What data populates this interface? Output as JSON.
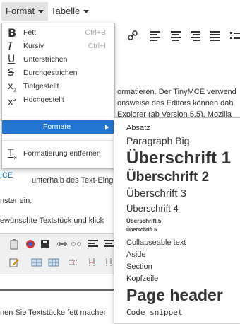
{
  "menubar": {
    "format": "Format",
    "table": "Tabelle"
  },
  "dropdown": {
    "items": [
      {
        "label": "Fett",
        "shortcut": "Ctrl+B",
        "icon": "bold-icon"
      },
      {
        "label": "Kursiv",
        "shortcut": "Ctrl+I",
        "icon": "italic-icon"
      },
      {
        "label": "Unterstrichen",
        "icon": "underline-icon"
      },
      {
        "label": "Durchgestrichen",
        "icon": "strikethrough-icon"
      },
      {
        "label": "Tiefgestellt",
        "icon": "subscript-icon"
      },
      {
        "label": "Hochgestellt",
        "icon": "superscript-icon"
      }
    ],
    "formats": "Formate",
    "clear": "Formatierung entfernen"
  },
  "submenu": [
    "Absatz",
    "Paragraph Big",
    "Überschrift 1",
    "Überschrift 2",
    "Überschrift 3",
    "Überschrift 4",
    "Überschrift 5",
    "Überschrift 6",
    "Collapseable text",
    "Aside",
    "Section",
    "Kopfzeile",
    "Page header",
    "Code snippet"
  ],
  "background": {
    "line1": "ormatieren. Der TinyMCE verwend",
    "line2": "onsweise des Editors können dah",
    "line3": "Explorer (ab Version 5.5), Mozilla",
    "mce": "ICE",
    "line4": "unterhalb des Text-Eing",
    "line5": "nster ein.",
    "line6": "ewünschte Textstück und klick",
    "line7": "nen Sie Textstücke fett macher"
  },
  "colors": {
    "accent": "#2276d2",
    "menu_border": "#bbbbbb"
  }
}
